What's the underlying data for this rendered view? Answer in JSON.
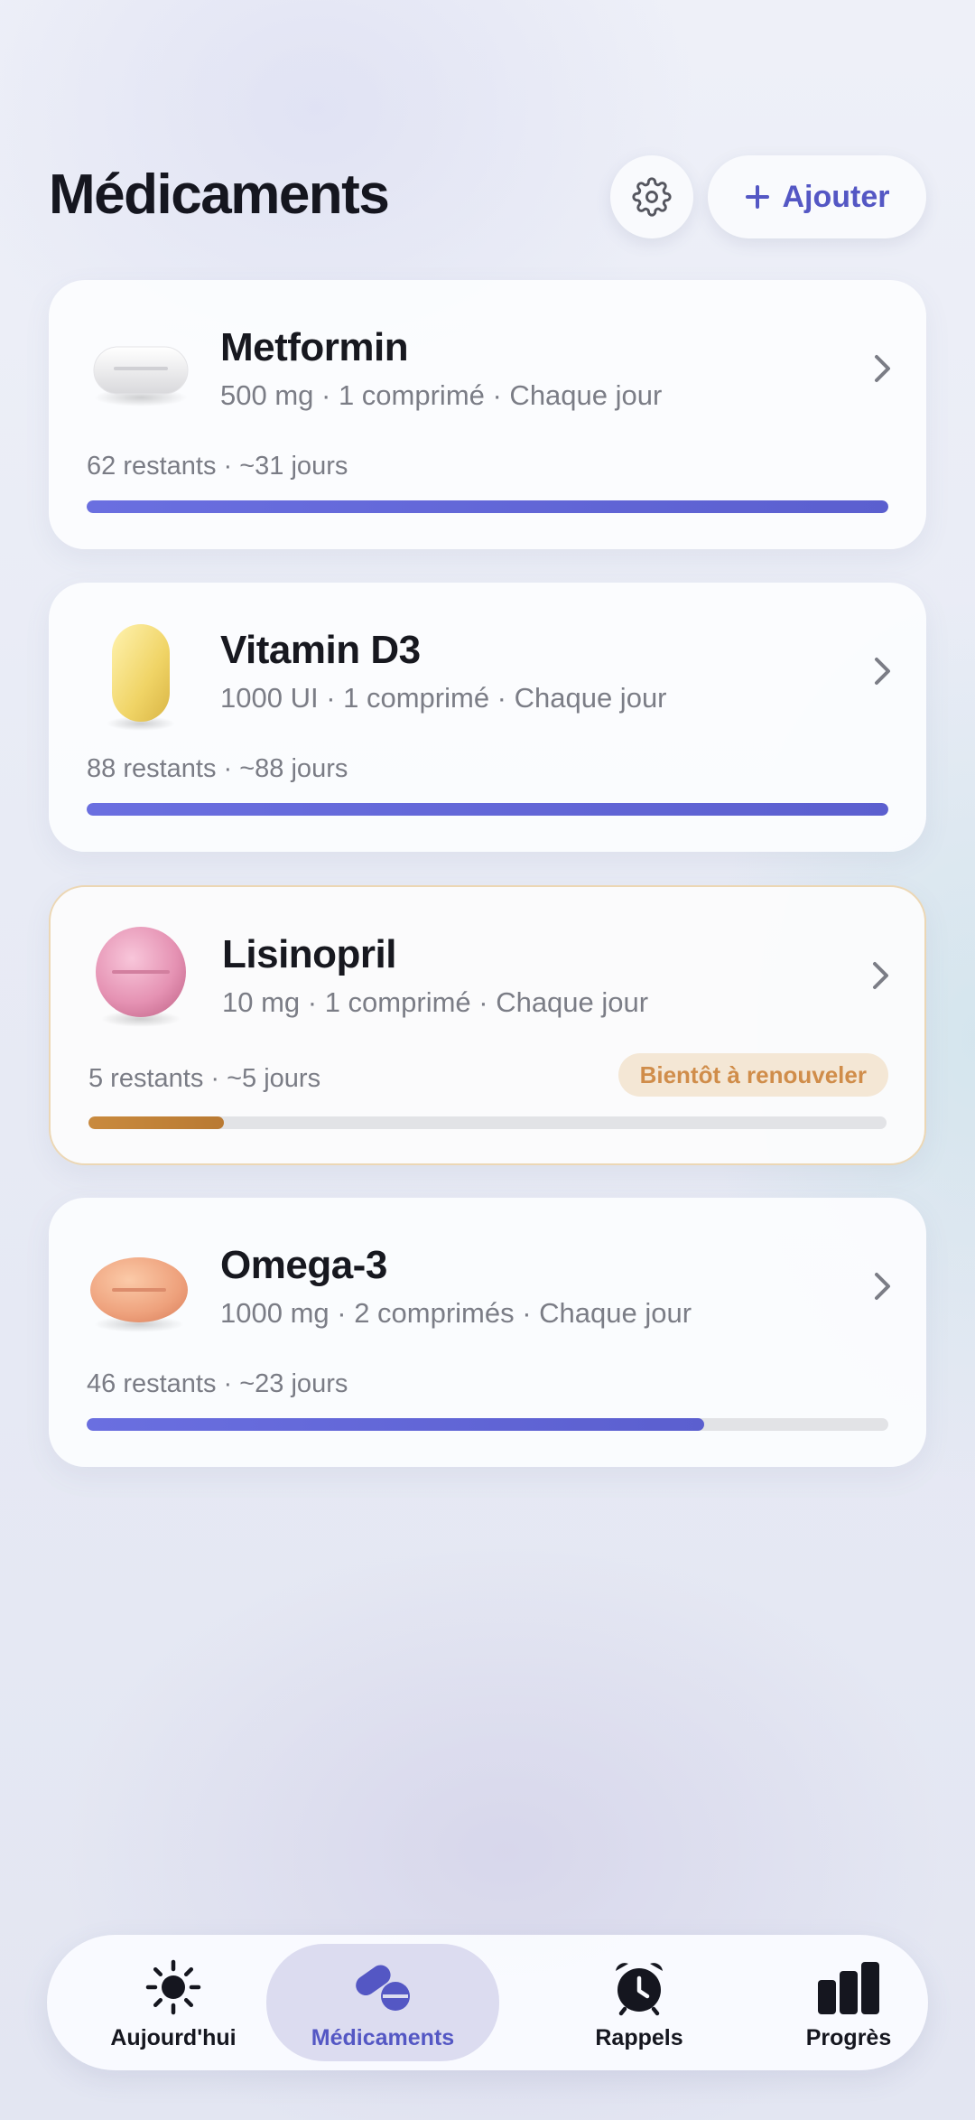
{
  "header": {
    "title": "Médicaments",
    "add_label": "Ajouter"
  },
  "medications": [
    {
      "name": "Metformin",
      "dose": "500 mg · 1 comprimé · Chaque jour",
      "remaining": "62 restants · ~31 jours",
      "supply_fraction": 1.0,
      "pill_icon": "white-capsule-tablet-icon"
    },
    {
      "name": "Vitamin D3",
      "dose": "1000 UI · 1 comprimé · Chaque jour",
      "remaining": "88 restants · ~88 jours",
      "supply_fraction": 1.0,
      "pill_icon": "yellow-softgel-icon"
    },
    {
      "name": "Lisinopril",
      "dose": "10 mg · 1 comprimé · Chaque jour",
      "remaining": "5 restants · ~5 jours",
      "supply_fraction": 0.17,
      "badge": "Bientôt à renouveler",
      "pill_icon": "pink-round-tablet-icon"
    },
    {
      "name": "Omega-3",
      "dose": "1000 mg · 2 comprimés · Chaque jour",
      "remaining": "46 restants · ~23 jours",
      "supply_fraction": 0.77,
      "pill_icon": "orange-oval-tablet-icon"
    }
  ],
  "nav": {
    "items": [
      {
        "label": "Aujourd'hui",
        "icon": "sun-icon"
      },
      {
        "label": "Médicaments",
        "icon": "pills-icon",
        "active": true
      },
      {
        "label": "Rappels",
        "icon": "alarm-clock-icon"
      },
      {
        "label": "Progrès",
        "icon": "bar-chart-icon"
      }
    ]
  },
  "colors": {
    "accent": "#5457C4",
    "progress": "#6366D8",
    "warning": "#C1843A",
    "badge_bg": "#F4E7D5"
  }
}
